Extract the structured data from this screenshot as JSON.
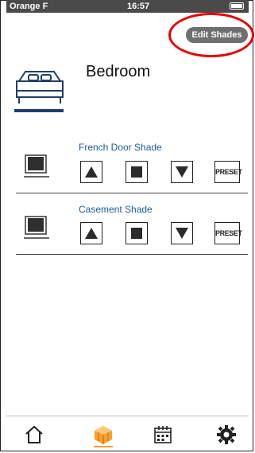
{
  "status": {
    "carrier": "Orange F",
    "time": "16:57"
  },
  "header": {
    "edit_label": "Edit Shades"
  },
  "room": {
    "title": "Bedroom"
  },
  "shades": [
    {
      "name": "French Door Shade",
      "preset_label": "PRESET"
    },
    {
      "name": "Casement Shade",
      "preset_label": "PRESET"
    }
  ],
  "colors": {
    "accent": "#f7a02a",
    "link": "#1e5aa0",
    "highlight": "#e60000",
    "room_underline": "#1f3f66"
  },
  "tabs": [
    {
      "icon": "home-icon"
    },
    {
      "icon": "shades-icon",
      "active": true
    },
    {
      "icon": "calendar-icon"
    },
    {
      "icon": "gear-icon"
    }
  ]
}
